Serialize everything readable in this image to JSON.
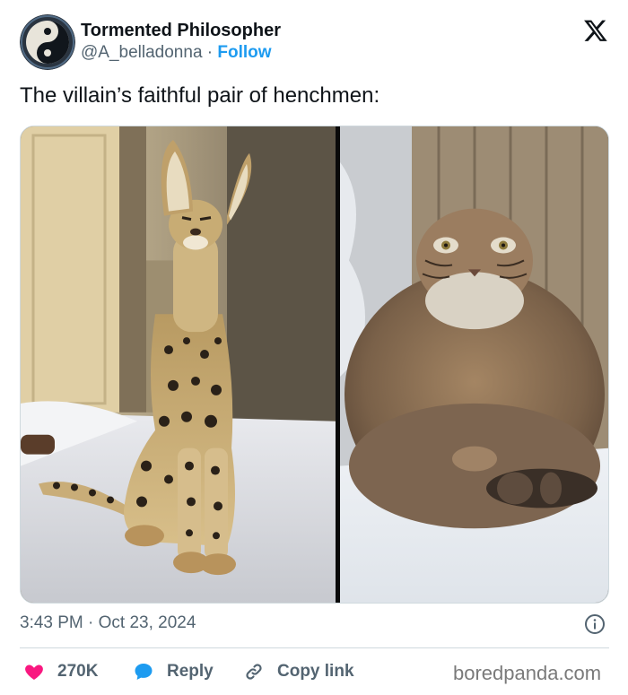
{
  "author": {
    "display_name": "Tormented Philosopher",
    "handle": "@A_belladonna",
    "separator": "·",
    "follow_label": "Follow",
    "avatar_icon": "yin-yang-icon"
  },
  "platform_logo": "x-logo-icon",
  "tweet": {
    "text": "The villain’s faithful pair of henchmen:",
    "timestamp": "3:43 PM · Oct 23, 2024"
  },
  "media": {
    "left_photo": "serval-cat-sitting-on-bed",
    "right_photo": "pallas-cat-sitting-in-snow"
  },
  "actions": {
    "like_count": "270K",
    "reply_label": "Reply",
    "copy_link_label": "Copy link"
  },
  "watermark": "boredpanda.com",
  "colors": {
    "like": "#f91880",
    "reply": "#1d9bf0",
    "follow": "#1d9bf0",
    "secondary_text": "#536471"
  }
}
